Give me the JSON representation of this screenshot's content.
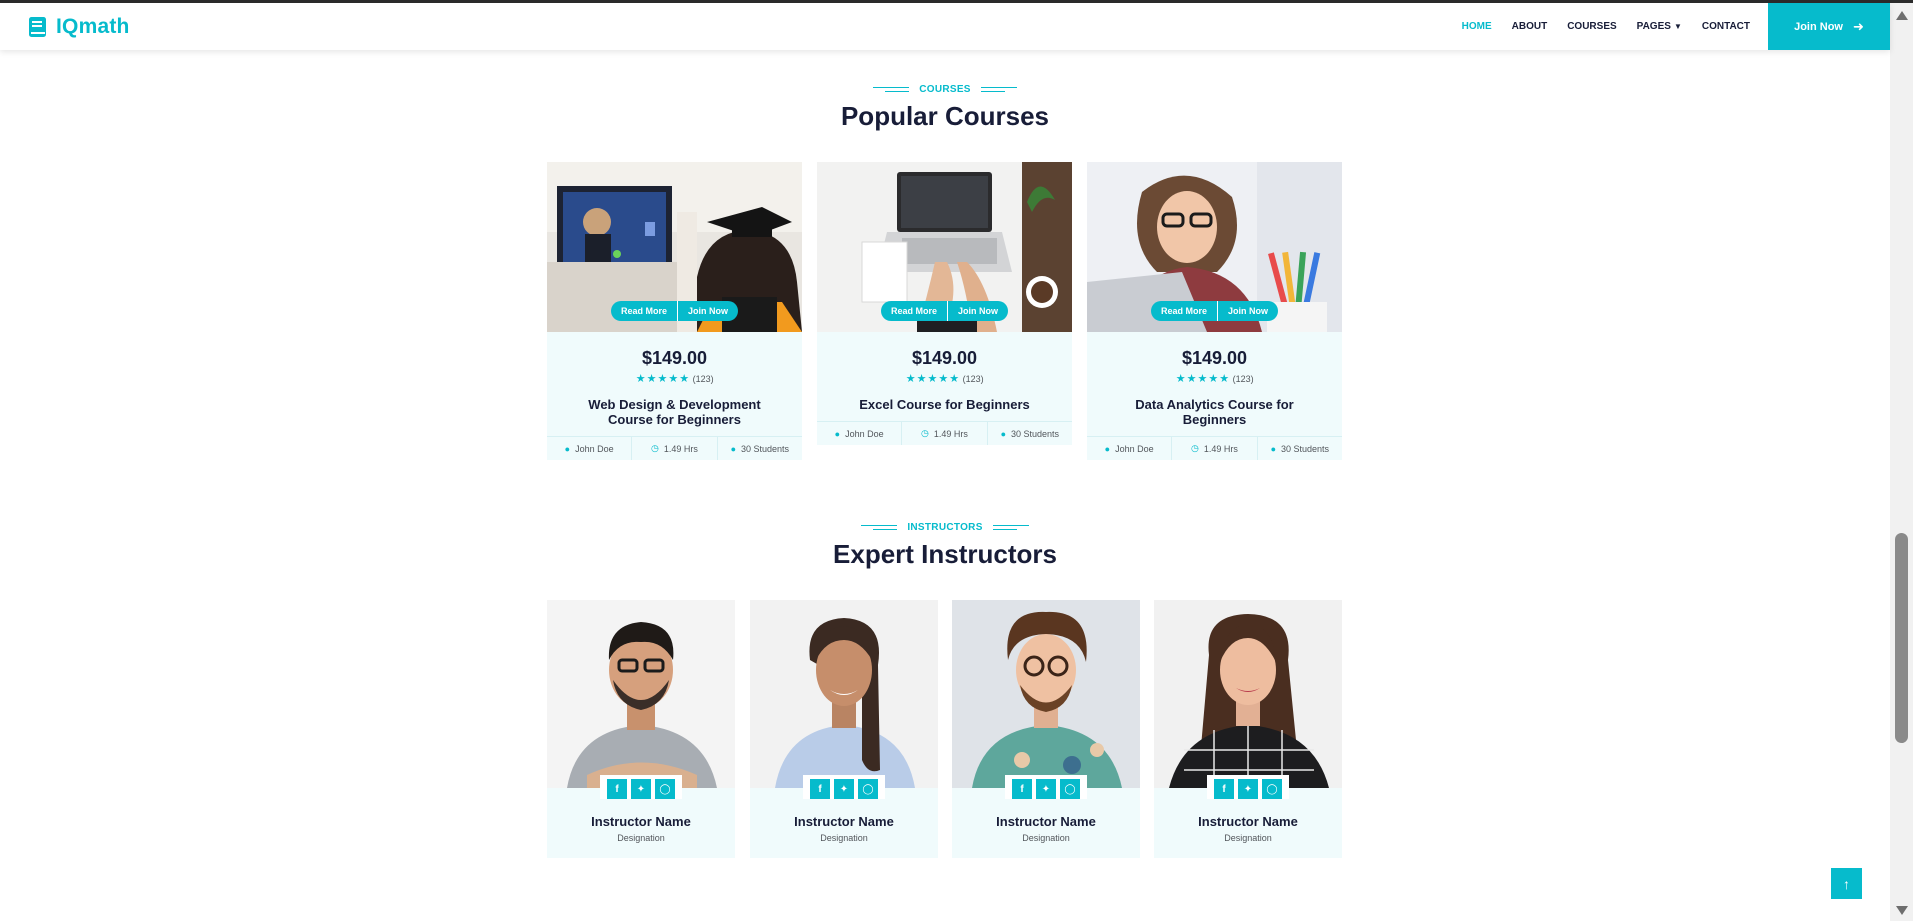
{
  "brand": {
    "name": "IQmath",
    "icon": "book-icon",
    "accent": "#06bbcc"
  },
  "nav": {
    "links": [
      "HOME",
      "ABOUT",
      "COURSES",
      "PAGES",
      "CONTACT"
    ],
    "active": "HOME",
    "join_label": "Join Now"
  },
  "courses_section": {
    "tag": "COURSES",
    "title": "Popular Courses",
    "read_more_label": "Read More",
    "join_label": "Join Now",
    "cards": [
      {
        "title": "Web Design & Development Course for Beginners",
        "price": "$149.00",
        "rating_count": "(123)",
        "rating": 5,
        "instructor": "John Doe",
        "duration": "1.49 Hrs",
        "students": "30 Students"
      },
      {
        "title": "Excel Course for Beginners",
        "price": "$149.00",
        "rating_count": "(123)",
        "rating": 5,
        "instructor": "John Doe",
        "duration": "1.49 Hrs",
        "students": "30 Students"
      },
      {
        "title": "Data Analytics Course for Beginners",
        "price": "$149.00",
        "rating_count": "(123)",
        "rating": 5,
        "instructor": "John Doe",
        "duration": "1.49 Hrs",
        "students": "30 Students"
      }
    ]
  },
  "instructors_section": {
    "tag": "INSTRUCTORS",
    "title": "Expert Instructors",
    "cards": [
      {
        "name": "Instructor Name",
        "designation": "Designation"
      },
      {
        "name": "Instructor Name",
        "designation": "Designation"
      },
      {
        "name": "Instructor Name",
        "designation": "Designation"
      },
      {
        "name": "Instructor Name",
        "designation": "Designation"
      }
    ]
  }
}
